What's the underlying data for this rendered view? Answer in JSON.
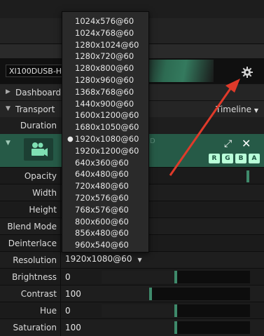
{
  "source": {
    "device": "XI100DUSB-HDM"
  },
  "sections": [
    {
      "label": "Dashboard",
      "right": ""
    },
    {
      "label": "Transport",
      "right": "Timeline"
    }
  ],
  "duration_label": "Duration",
  "card": {
    "letters": [
      "R",
      "G",
      "B",
      "A"
    ],
    "hidden_text": "D"
  },
  "properties": [
    {
      "name": "Opacity",
      "value": ""
    },
    {
      "name": "Width",
      "value": ""
    },
    {
      "name": "Height",
      "value": ""
    },
    {
      "name": "Blend Mode",
      "value": ""
    },
    {
      "name": "Deinterlace",
      "value": ""
    },
    {
      "name": "Resolution",
      "value": "1920x1080@60"
    },
    {
      "name": "Brightness",
      "value": "0",
      "level": 0.5
    },
    {
      "name": "Contrast",
      "value": "100",
      "level": 0.33
    },
    {
      "name": "Hue",
      "value": "0",
      "level": 0.5
    },
    {
      "name": "Saturation",
      "value": "100",
      "level": 0.5
    }
  ],
  "resolution_options": [
    "1024x576@60",
    "1024x768@60",
    "1280x1024@60",
    "1280x720@60",
    "1280x800@60",
    "1280x960@60",
    "1368x768@60",
    "1440x900@60",
    "1600x1200@60",
    "1680x1050@60",
    "1920x1080@60",
    "1920x1200@60",
    "640x360@60",
    "640x480@60",
    "720x480@60",
    "720x576@60",
    "768x576@60",
    "800x600@60",
    "856x480@60",
    "960x540@60"
  ],
  "selected_resolution_index": 10,
  "colors": {
    "accent": "#3f8a6b",
    "card": "#265a47",
    "arrow": "#e03a2a",
    "rgba_btn": "#b9ffd9"
  },
  "icons": [
    "gear-icon",
    "camera-icon",
    "expand-icon",
    "close-icon",
    "triangle-right-icon",
    "triangle-down-icon",
    "chevron-down-icon"
  ]
}
